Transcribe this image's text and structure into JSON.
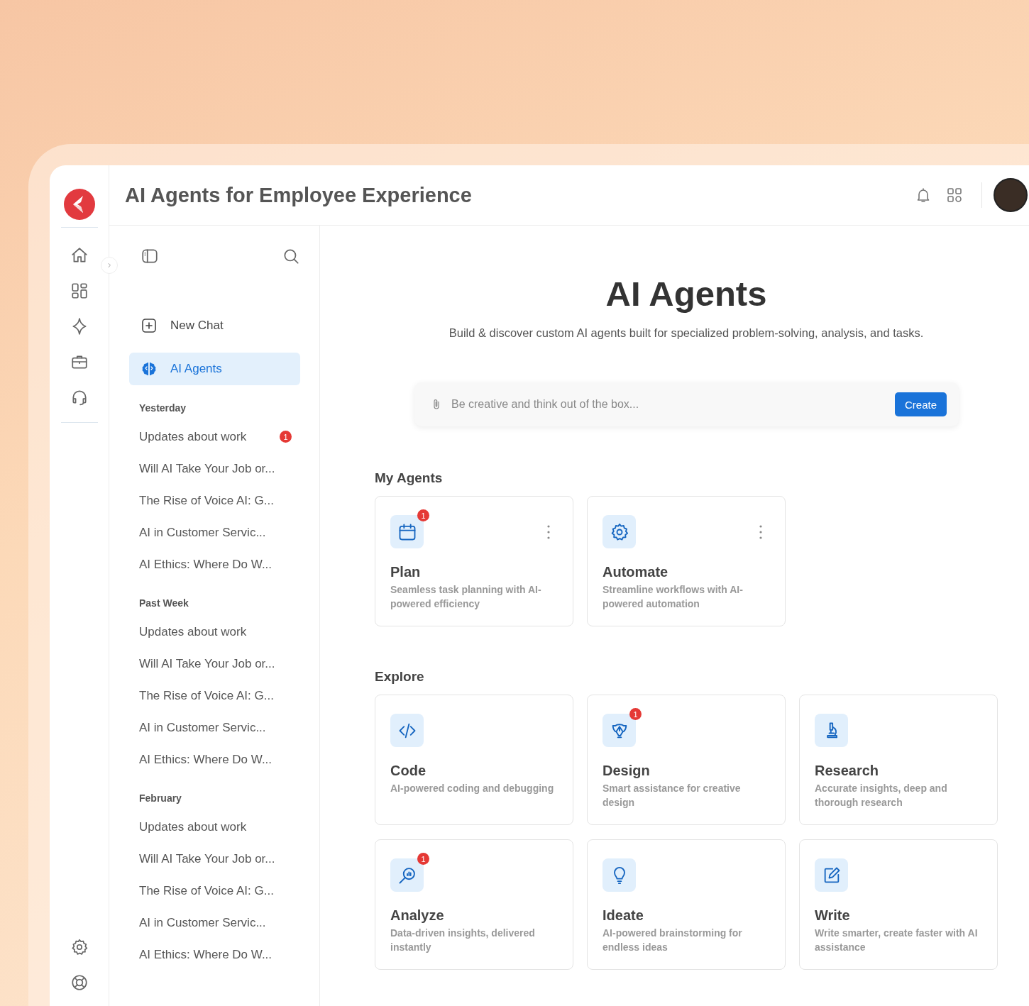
{
  "header": {
    "title": "AI Agents for Employee Experience"
  },
  "sidebar": {
    "nav": [
      {
        "label": "New Chat",
        "selected": false
      },
      {
        "label": "AI Agents",
        "selected": true
      }
    ],
    "history": [
      {
        "label": "Yesterday",
        "items": [
          {
            "title": "Updates about work",
            "badge": "1"
          },
          {
            "title": "Will AI Take Your Job or..."
          },
          {
            "title": "The Rise of Voice AI: G..."
          },
          {
            "title": "AI in Customer Servic..."
          },
          {
            "title": "AI Ethics: Where Do W..."
          }
        ]
      },
      {
        "label": "Past Week",
        "items": [
          {
            "title": "Updates about work"
          },
          {
            "title": "Will AI Take Your Job or..."
          },
          {
            "title": "The Rise of Voice AI: G..."
          },
          {
            "title": "AI in Customer Servic..."
          },
          {
            "title": "AI Ethics: Where Do W..."
          }
        ]
      },
      {
        "label": "February",
        "items": [
          {
            "title": "Updates about work"
          },
          {
            "title": "Will AI Take Your Job or..."
          },
          {
            "title": "The Rise of Voice AI: G..."
          },
          {
            "title": "AI in Customer Servic..."
          },
          {
            "title": "AI Ethics: Where Do W..."
          }
        ]
      }
    ]
  },
  "hero": {
    "title": "AI Agents",
    "subtitle": "Build & discover custom AI agents built for specialized problem-solving, analysis, and tasks.",
    "prompt": {
      "placeholder": "Be creative and think out of the box...",
      "button": "Create"
    }
  },
  "my_agents": {
    "heading": "My Agents",
    "cards": [
      {
        "title": "Plan",
        "description": "Seamless task planning with AI-powered efficiency",
        "badge": "1",
        "menu": true
      },
      {
        "title": "Automate",
        "description": "Streamline workflows with AI-powered automation",
        "menu": true
      }
    ]
  },
  "explore": {
    "heading": "Explore",
    "cards": [
      {
        "title": "Code",
        "description": "AI-powered coding and debugging"
      },
      {
        "title": "Design",
        "description": "Smart assistance for creative design",
        "badge": "1"
      },
      {
        "title": "Research",
        "description": "Accurate insights, deep and thorough research"
      },
      {
        "title": "Analyze",
        "description": "Data-driven insights, delivered instantly",
        "badge": "1"
      },
      {
        "title": "Ideate",
        "description": "AI-powered brainstorming for endless ideas"
      },
      {
        "title": "Write",
        "description": "Write smarter, create faster with AI assistance"
      }
    ]
  }
}
